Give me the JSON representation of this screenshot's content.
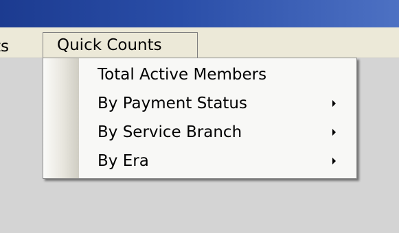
{
  "window": {
    "menu_bar": {
      "partial_item_label": "ts",
      "open_menu_label": "Quick Counts"
    }
  },
  "dropdown": {
    "items": [
      {
        "label": "Total Active Members",
        "has_submenu": false
      },
      {
        "label": "By Payment Status",
        "has_submenu": true,
        "arrow_icon": "submenu-arrow-icon"
      },
      {
        "label": "By Service Branch",
        "has_submenu": true,
        "arrow_icon": "submenu-arrow-icon"
      },
      {
        "label": "By Era",
        "has_submenu": true,
        "arrow_icon": "submenu-arrow-icon"
      }
    ]
  },
  "colors": {
    "title_bar": "#2a4ea8",
    "menu_bar": "#ece9d8",
    "content_background": "#d4d4d4",
    "dropdown_background": "#f8f8f6"
  }
}
